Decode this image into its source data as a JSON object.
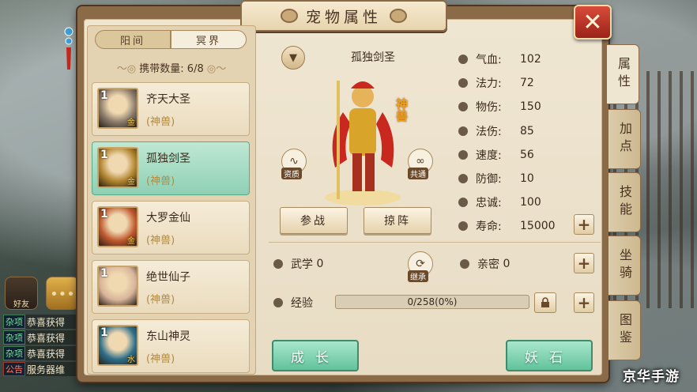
{
  "window": {
    "title": "宠物属性",
    "close_symbol": "✕"
  },
  "side": {
    "friends_label": "好友",
    "chat_icon": "chat-bubble-icon",
    "chat": [
      {
        "tag": "杂项",
        "text": "恭喜获得"
      },
      {
        "tag": "杂项",
        "text": "恭喜获得"
      },
      {
        "tag": "杂项",
        "text": "恭喜获得"
      },
      {
        "tag": "公告",
        "text": "服务器维"
      }
    ]
  },
  "left": {
    "segments": [
      "阳间",
      "冥界"
    ],
    "carry_label": "携带数量:",
    "carry_value": "6/8",
    "pets": [
      {
        "name": "齐天大圣",
        "type": "(神兽)",
        "level": "1",
        "grade": "金",
        "color": "#8a7a6a"
      },
      {
        "name": "孤独剑圣",
        "type": "(神兽)",
        "level": "1",
        "grade": "金",
        "color": "#b0842e"
      },
      {
        "name": "大罗金仙",
        "type": "(神兽)",
        "level": "1",
        "grade": "金",
        "color": "#c0582e"
      },
      {
        "name": "绝世仙子",
        "type": "(神兽)",
        "level": "1",
        "grade": "",
        "color": "#d8b49a"
      },
      {
        "name": "东山神灵",
        "type": "(神兽)",
        "level": "1",
        "grade": "水",
        "color": "#2e6f8a"
      }
    ],
    "selected_index": 1
  },
  "center": {
    "pet_name": "孤独剑圣",
    "badge": "神兽",
    "aptitude_label": "资质",
    "share_label": "共通",
    "fight_button": "参战",
    "formation_button": "掠阵",
    "inherit_label": "继承"
  },
  "stats": [
    {
      "label": "气血:",
      "value": "102",
      "icon": "blood-icon"
    },
    {
      "label": "法力:",
      "value": "72",
      "icon": "mana-icon"
    },
    {
      "label": "物伤:",
      "value": "150",
      "icon": "sword-icon"
    },
    {
      "label": "法伤:",
      "value": "85",
      "icon": "flame-icon"
    },
    {
      "label": "速度:",
      "value": "56",
      "icon": "speed-icon"
    },
    {
      "label": "防御:",
      "value": "10",
      "icon": "shield-icon"
    },
    {
      "label": "忠诚:",
      "value": "100",
      "icon": "heart-icon"
    },
    {
      "label": "寿命:",
      "value": "15000",
      "icon": "hourglass-icon"
    }
  ],
  "extra": {
    "martial_label": "武学",
    "martial_value": "0",
    "intimacy_label": "亲密",
    "intimacy_value": "0",
    "exp_label": "经验",
    "exp_text": "0/258(0%)",
    "exp_fraction": 0
  },
  "buttons": {
    "grow": "成长",
    "stone": "妖石"
  },
  "tabs": [
    "属性",
    "加点",
    "技能",
    "坐骑",
    "图鉴"
  ],
  "active_tab": 0,
  "watermark": "京华手游"
}
